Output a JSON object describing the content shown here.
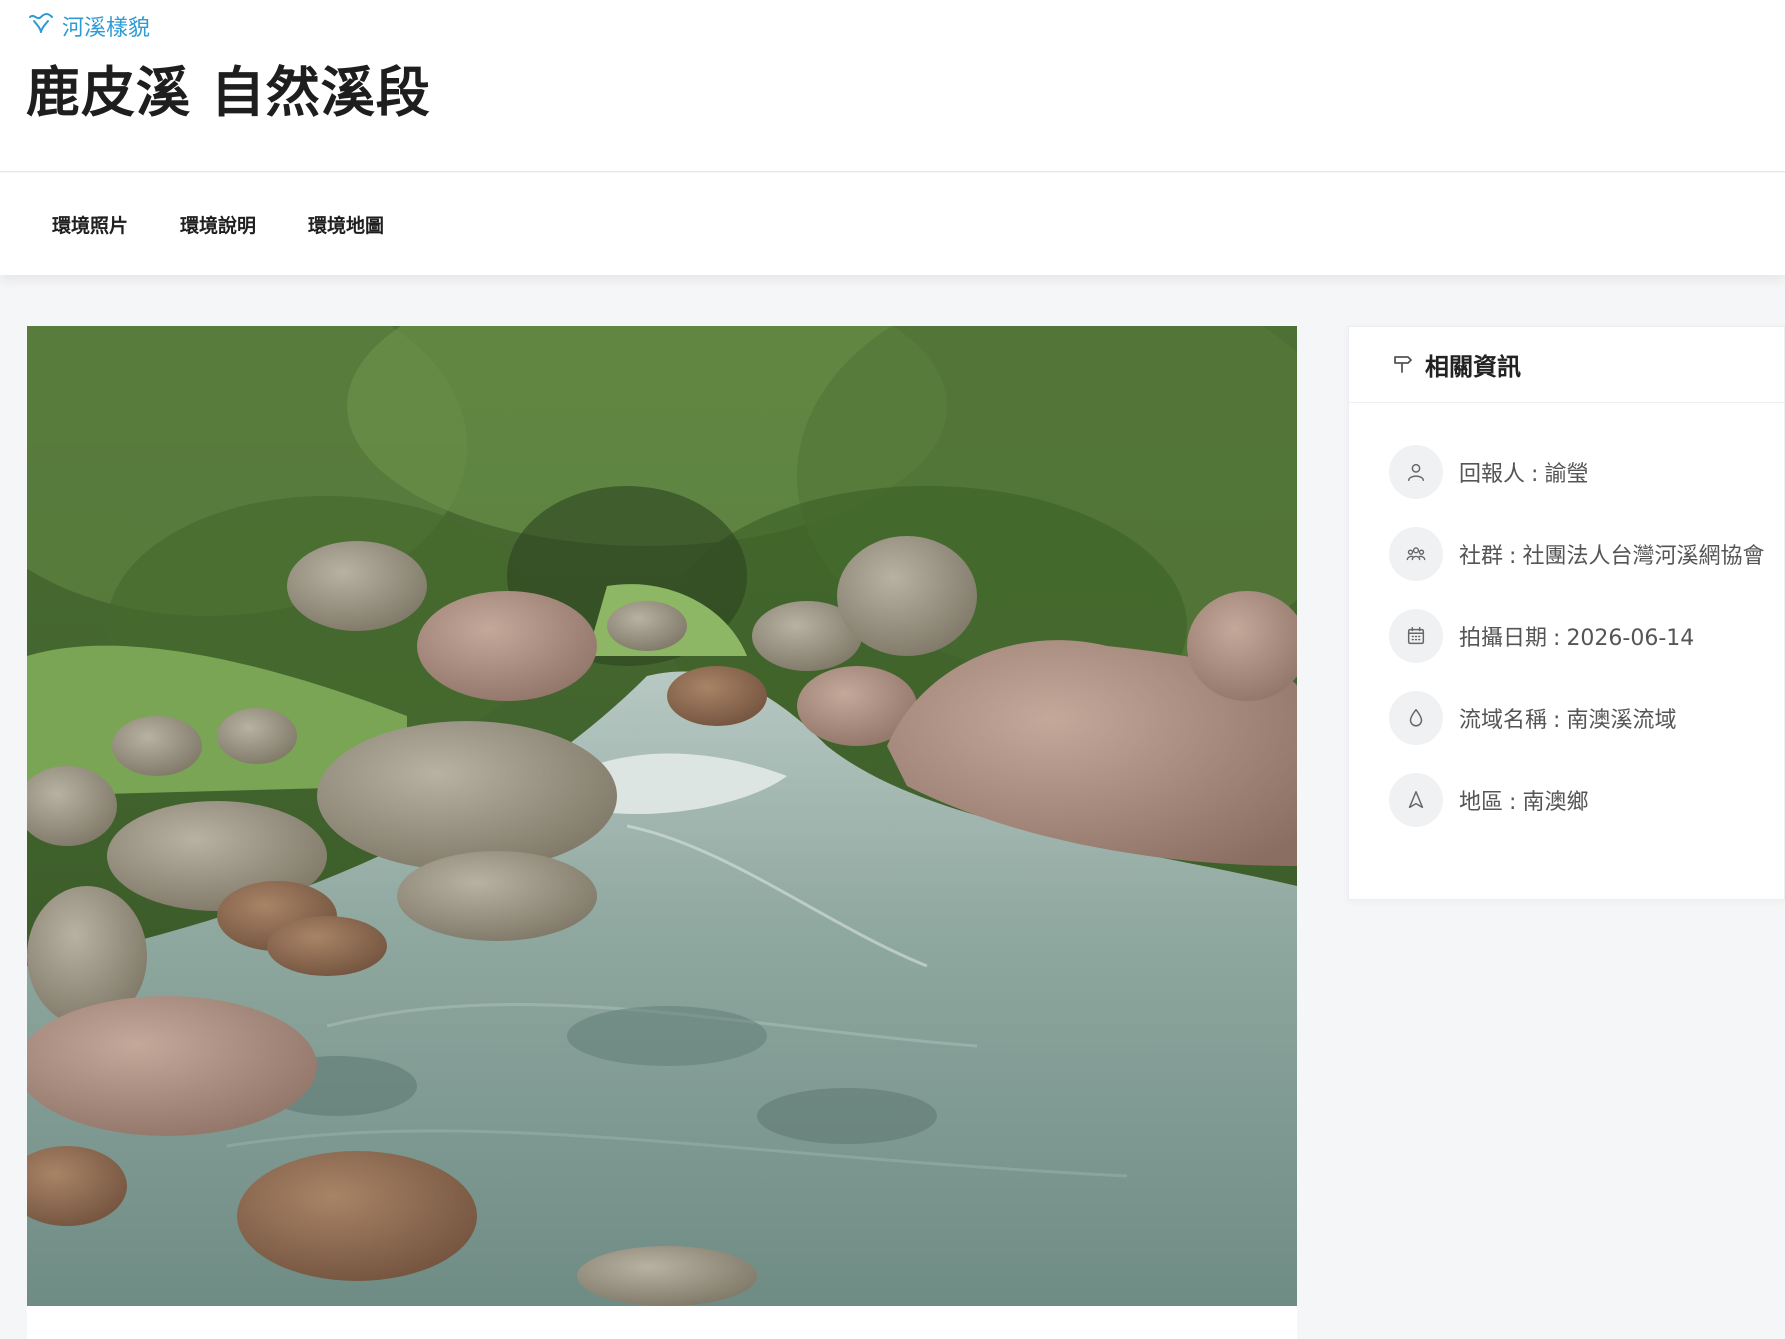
{
  "header": {
    "category": "河溪樣貌",
    "category_icon": "river-icon",
    "title": "鹿皮溪 自然溪段"
  },
  "tabs": [
    {
      "label": "環境照片"
    },
    {
      "label": "環境說明"
    },
    {
      "label": "環境地圖"
    }
  ],
  "photo": {
    "subject": "river-photo"
  },
  "info_card": {
    "title": "相關資訊",
    "title_icon": "signpost-icon",
    "items": [
      {
        "icon": "user-icon",
        "label": "回報人",
        "value": "諭瑩"
      },
      {
        "icon": "group-icon",
        "label": "社群",
        "value": "社團法人台灣河溪網協會"
      },
      {
        "icon": "calendar-icon",
        "label": "拍攝日期",
        "value": "2026-06-14"
      },
      {
        "icon": "water-drop-icon",
        "label": "流域名稱",
        "value": "南澳溪流域"
      },
      {
        "icon": "location-icon",
        "label": "地區",
        "value": "南澳鄉"
      }
    ]
  },
  "colors": {
    "accent": "#2f9bd6",
    "background": "#f5f6f8",
    "card": "#ffffff"
  }
}
